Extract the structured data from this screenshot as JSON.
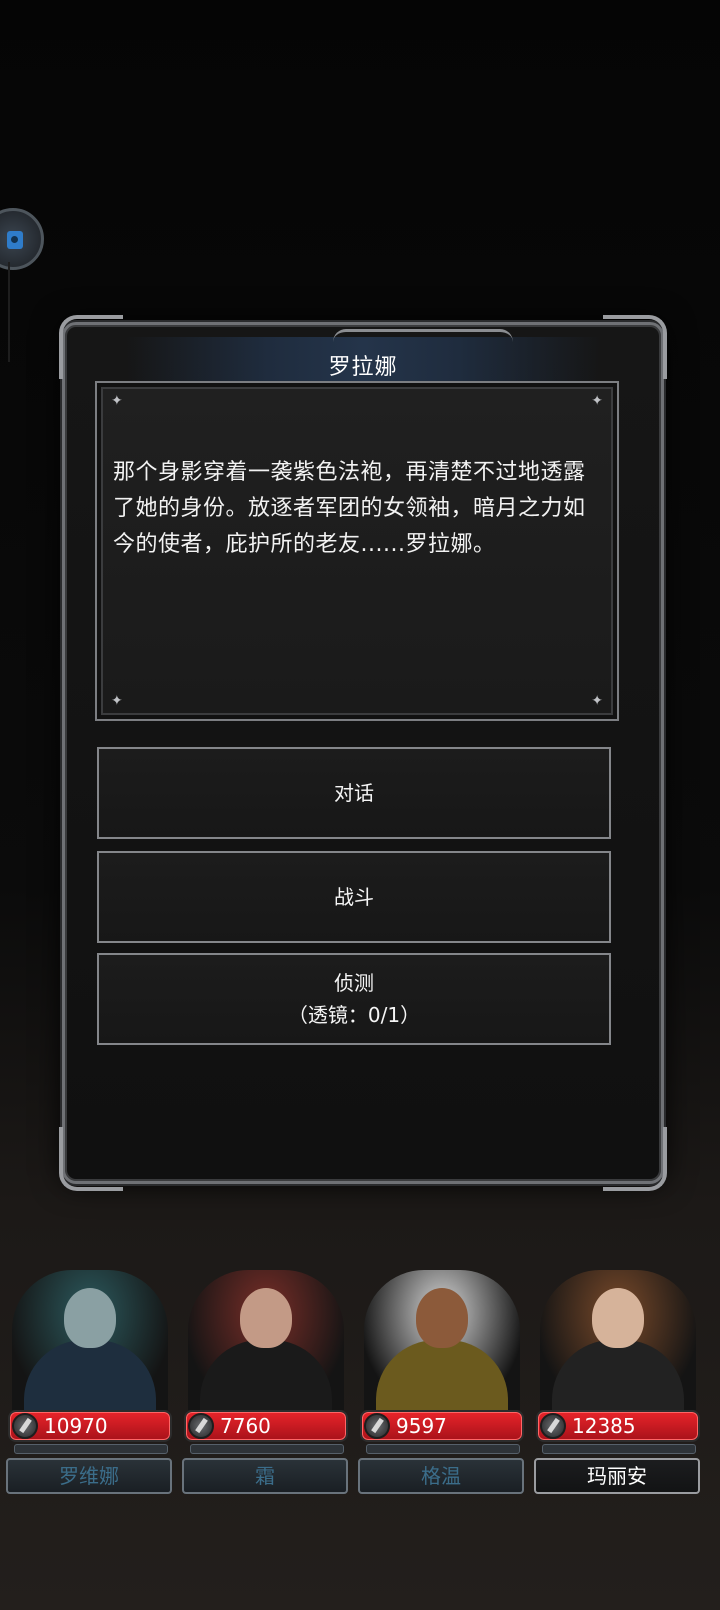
{
  "dialog": {
    "title": "罗拉娜",
    "story": "那个身影穿着一袭紫色法袍，再清楚不过地透露了她的身份。放逐者军团的女领袖，暗月之力如今的使者，庇护所的老友......罗拉娜。",
    "options": [
      {
        "label": "对话",
        "sub": ""
      },
      {
        "label": "战斗",
        "sub": ""
      },
      {
        "label": "侦测",
        "sub": "（透镜：0/1）"
      }
    ]
  },
  "party": [
    {
      "name": "罗维娜",
      "hp": "10970",
      "active": false,
      "colors": {
        "hair": "#2c5a5e",
        "skin": "#8aa0a3",
        "robe": "#1e2e3e"
      }
    },
    {
      "name": "霜",
      "hp": "7760",
      "active": false,
      "colors": {
        "hair": "#7a2e28",
        "skin": "#c39a86",
        "robe": "#1a1a1a"
      }
    },
    {
      "name": "格温",
      "hp": "9597",
      "active": false,
      "colors": {
        "hair": "#d8d8d8",
        "skin": "#8c5a3a",
        "robe": "#6b5a1e"
      }
    },
    {
      "name": "玛丽安",
      "hp": "12385",
      "active": true,
      "colors": {
        "hair": "#7a4a2a",
        "skin": "#d6b39a",
        "robe": "#222222"
      }
    }
  ]
}
